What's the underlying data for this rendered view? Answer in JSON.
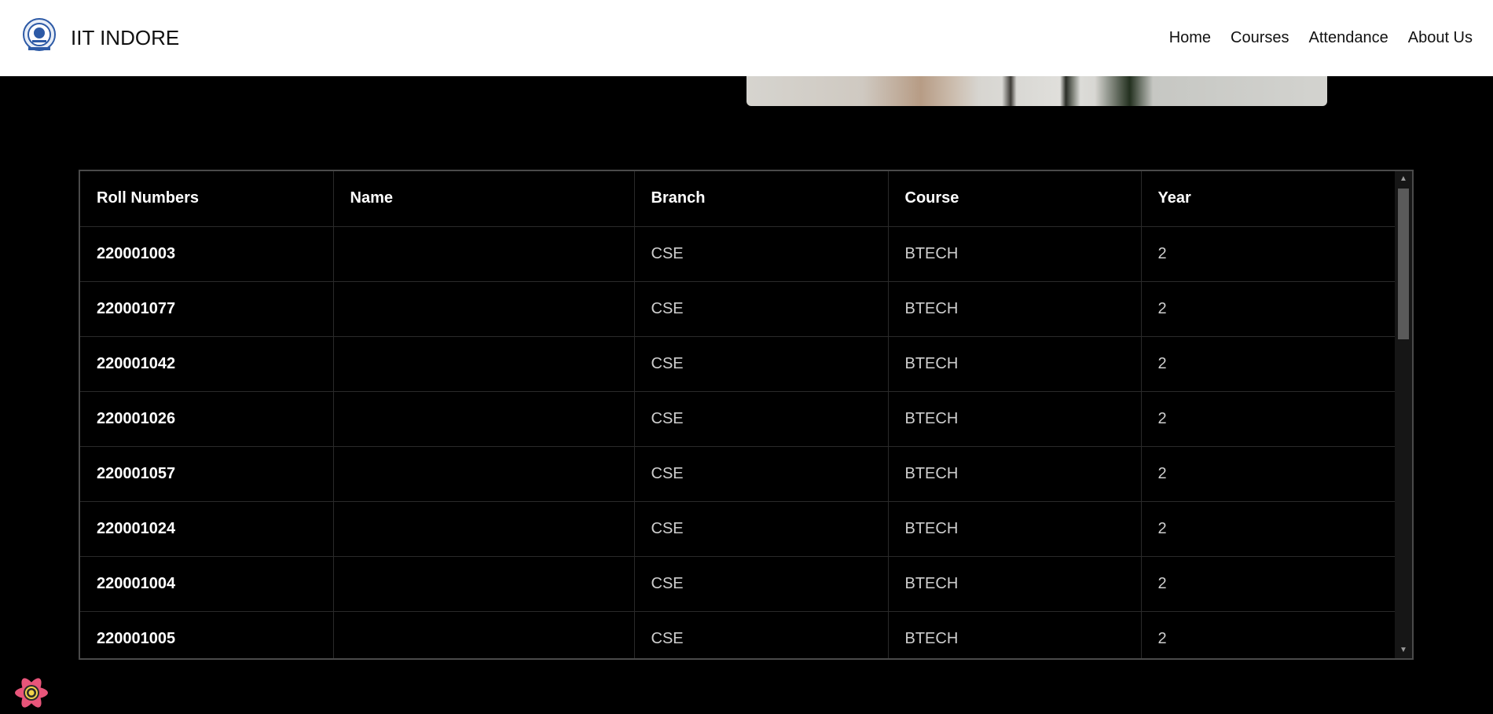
{
  "navbar": {
    "brand": "IIT INDORE",
    "links": [
      "Home",
      "Courses",
      "Attendance",
      "About Us"
    ]
  },
  "table": {
    "headers": [
      "Roll Numbers",
      "Name",
      "Branch",
      "Course",
      "Year"
    ],
    "rows": [
      {
        "roll": "220001003",
        "name": "",
        "branch": "CSE",
        "course": "BTECH",
        "year": "2"
      },
      {
        "roll": "220001077",
        "name": "",
        "branch": "CSE",
        "course": "BTECH",
        "year": "2"
      },
      {
        "roll": "220001042",
        "name": "",
        "branch": "CSE",
        "course": "BTECH",
        "year": "2"
      },
      {
        "roll": "220001026",
        "name": "",
        "branch": "CSE",
        "course": "BTECH",
        "year": "2"
      },
      {
        "roll": "220001057",
        "name": "",
        "branch": "CSE",
        "course": "BTECH",
        "year": "2"
      },
      {
        "roll": "220001024",
        "name": "",
        "branch": "CSE",
        "course": "BTECH",
        "year": "2"
      },
      {
        "roll": "220001004",
        "name": "",
        "branch": "CSE",
        "course": "BTECH",
        "year": "2"
      },
      {
        "roll": "220001005",
        "name": "",
        "branch": "CSE",
        "course": "BTECH",
        "year": "2"
      }
    ]
  },
  "icons": {
    "logo": "institute-seal-icon",
    "badge": "react-devtools-icon",
    "scroll_up": "scroll-up-arrow-icon",
    "scroll_down": "scroll-down-arrow-icon"
  }
}
